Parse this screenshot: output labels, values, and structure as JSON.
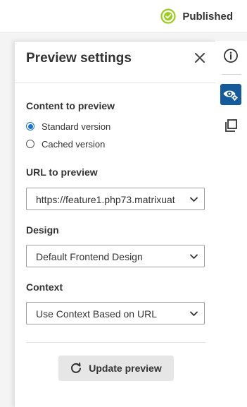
{
  "topbar": {
    "status_text": "Published",
    "status_icon": "check-circle-icon",
    "status_color": "#9acd1a"
  },
  "panel": {
    "title": "Preview settings",
    "close_icon": "close-icon",
    "content_section": {
      "label": "Content to preview",
      "options": [
        {
          "label": "Standard version",
          "checked": true
        },
        {
          "label": "Cached version",
          "checked": false
        }
      ]
    },
    "url_section": {
      "label": "URL to preview",
      "value": "https://feature1.php73.matrixuat"
    },
    "design_section": {
      "label": "Design",
      "value": "Default Frontend Design"
    },
    "context_section": {
      "label": "Context",
      "value": "Use Context Based on URL"
    },
    "update_button": {
      "label": "Update preview",
      "icon": "refresh-icon"
    }
  },
  "rail": {
    "items": [
      {
        "icon": "info-icon",
        "active": false
      },
      {
        "icon": "preview-settings-icon",
        "active": true
      },
      {
        "icon": "copy-icon",
        "active": false
      }
    ],
    "active_color": "#155a9a"
  },
  "accent": "#1a73c8"
}
